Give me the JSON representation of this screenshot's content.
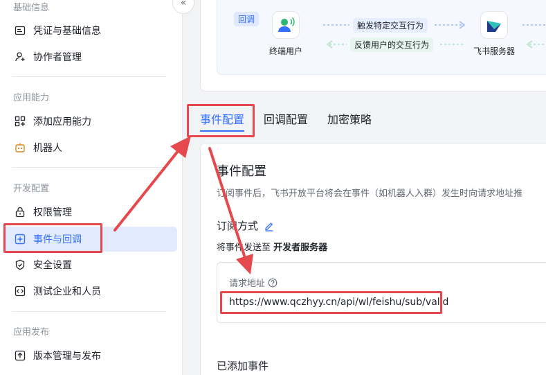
{
  "sidebar": {
    "sections": [
      {
        "title": "基础信息",
        "items": [
          {
            "label": "凭证与基础信息",
            "icon": "credential-icon"
          },
          {
            "label": "协作者管理",
            "icon": "user-add-icon"
          }
        ]
      },
      {
        "title": "应用能力",
        "items": [
          {
            "label": "添加应用能力",
            "icon": "apps-add-icon"
          },
          {
            "label": "机器人",
            "icon": "robot-icon"
          }
        ]
      },
      {
        "title": "开发配置",
        "items": [
          {
            "label": "权限管理",
            "icon": "lock-icon"
          },
          {
            "label": "事件与回调",
            "icon": "event-icon",
            "active": true
          },
          {
            "label": "安全设置",
            "icon": "shield-icon"
          },
          {
            "label": "测试企业和人员",
            "icon": "code-icon"
          }
        ]
      },
      {
        "title": "应用发布",
        "items": [
          {
            "label": "版本管理与发布",
            "icon": "upload-icon"
          }
        ]
      }
    ],
    "collapse_label": "«"
  },
  "diagram": {
    "tag": "回调",
    "left_node": "终端用户",
    "right_node": "飞书服务器",
    "flow_forward": "触发特定交互行为",
    "flow_back": "反馈用户的交互行为"
  },
  "tabs": [
    "事件配置",
    "回调配置",
    "加密策略"
  ],
  "event_config": {
    "title": "事件配置",
    "description": "订阅事件后，飞书开放平台将会在事件（如机器人入群）发生时向请求地址推",
    "subscribe_title": "订阅方式",
    "send_prefix": "将事件发送至",
    "send_target": "开发者服务器",
    "url_label": "请求地址",
    "url_value": "https://www.qczhyy.cn/api/wl/feishu/sub/valid",
    "added_events_title": "已添加事件"
  },
  "colors": {
    "accent": "#3370ff",
    "annotation": "#e5484d",
    "active_bg": "#e1eaff"
  }
}
